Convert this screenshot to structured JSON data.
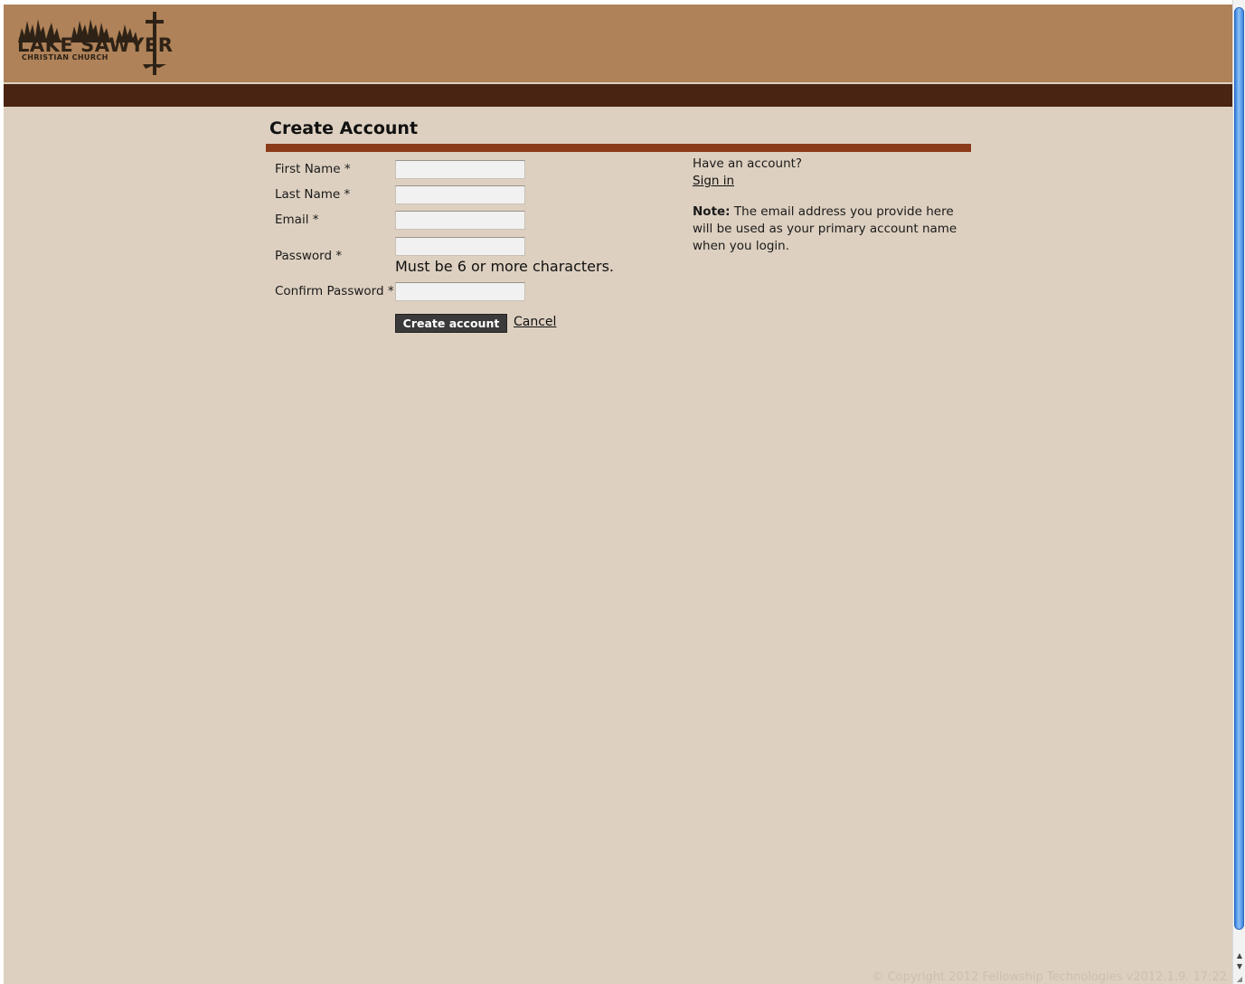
{
  "header": {
    "logo_text": "LAKE SAWYER",
    "logo_tagline": "CHRISTIAN CHURCH"
  },
  "page": {
    "title": "Create Account"
  },
  "form": {
    "first_name_label": "First Name *",
    "last_name_label": "Last Name *",
    "email_label": "Email *",
    "password_label": "Password *",
    "password_hint": "Must be 6 or more characters.",
    "confirm_password_label": "Confirm Password *",
    "first_name_value": "",
    "last_name_value": "",
    "email_value": "",
    "password_value": "",
    "confirm_password_value": "",
    "create_button_label": "Create account",
    "cancel_label": "Cancel"
  },
  "sidebar": {
    "have_account_text": "Have an account?",
    "signin_label": "Sign in",
    "note_bold": "Note:",
    "note_text": " The email address you provide here will be used as your primary account name when you login."
  },
  "footer": {
    "copyright": "© Copyright 2012 Fellowship Technologies  v2012.1.9. 17:22"
  },
  "colors": {
    "header_tan": "#af8259",
    "header_bar": "#4a2412",
    "background": "#ddd0c0",
    "title_rule": "#8b3a1a",
    "button": "#3a3a3a"
  }
}
